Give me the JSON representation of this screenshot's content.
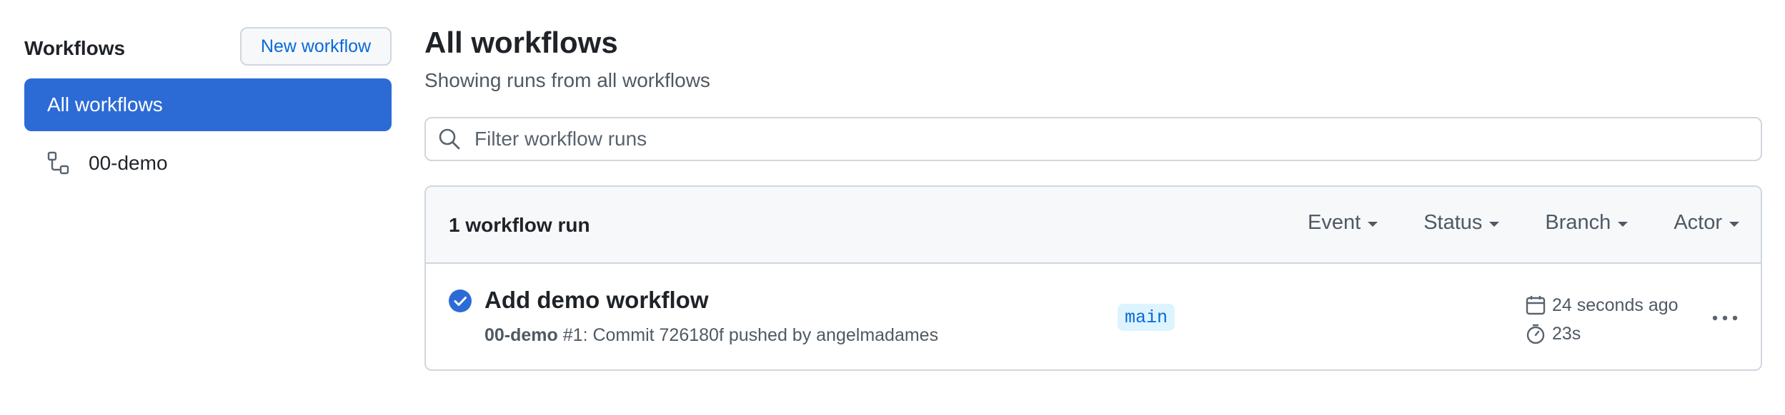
{
  "sidebar": {
    "title": "Workflows",
    "new_workflow_label": "New workflow",
    "items": [
      {
        "label": "All workflows",
        "active": true
      },
      {
        "label": "00-demo",
        "icon": "workflow-icon"
      }
    ]
  },
  "main": {
    "title": "All workflows",
    "subtitle": "Showing runs from all workflows",
    "search": {
      "placeholder": "Filter workflow runs",
      "value": ""
    },
    "runs_header": {
      "count_label": "1 workflow run",
      "filters": [
        "Event",
        "Status",
        "Branch",
        "Actor"
      ]
    },
    "runs": [
      {
        "status": "success",
        "title": "Add demo workflow",
        "workflow": "00-demo",
        "meta_rest": "#1: Commit 726180f pushed by angelmadames",
        "branch": "main",
        "time_ago": "24 seconds ago",
        "duration": "23s"
      }
    ]
  },
  "colors": {
    "accent": "#2c6bd6",
    "link": "#0969da",
    "success": "#2c6bd6",
    "border": "#d0d7de",
    "header_bg": "#f6f8fa"
  }
}
